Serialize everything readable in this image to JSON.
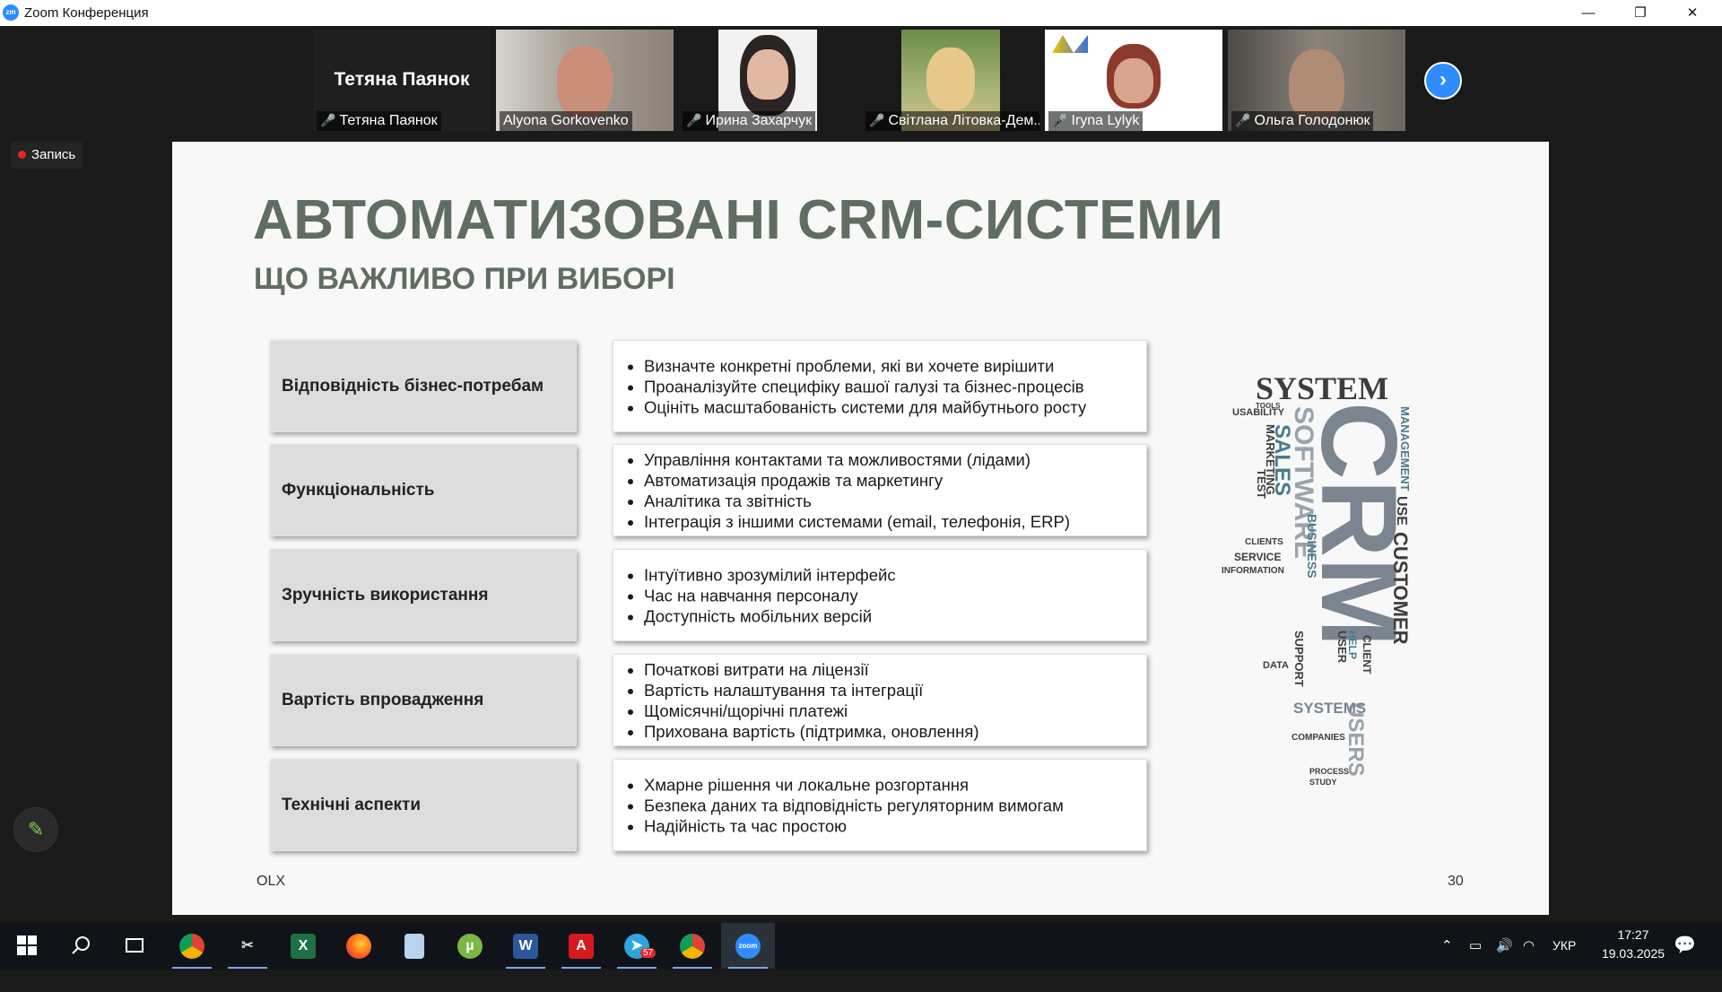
{
  "window": {
    "title": "Zoom Конференция",
    "icon_label": "zm",
    "minimize": "—",
    "restore": "❐",
    "close": "✕"
  },
  "participants": [
    {
      "name": "Тетяна Паянок",
      "display": "Тетяна Паянок",
      "muted": true
    },
    {
      "name": "Alyona Gorkovenko",
      "muted": false
    },
    {
      "name": "Ирина Захарчук",
      "muted": true
    },
    {
      "name": "Світлана Літовка-Дем...",
      "muted": true
    },
    {
      "name": "Iryna Lylyk",
      "muted": true
    },
    {
      "name": "Ольга Голодонюк",
      "muted": true
    }
  ],
  "next_arrow": "›",
  "recording": {
    "label": "Запись"
  },
  "slide": {
    "title": "АВТОМАТИЗОВАНІ CRM-СИСТЕМИ",
    "subtitle": "ЩО ВАЖЛИВО ПРИ ВИБОРІ",
    "rows": [
      {
        "category": "Відповідність бізнес-потребам",
        "items": [
          "Визначте конкретні проблеми, які ви хочете вирішити",
          "Проаналізуйте специфіку вашої галузі та бізнес-процесів",
          "Оцініть масштабованість системи для майбутнього росту"
        ]
      },
      {
        "category": "Функціональність",
        "items": [
          "Управління контактами та можливостями (лідами)",
          "Автоматизація продажів та маркетингу",
          "Аналітика та звітність",
          "Інтеграція з іншими системами (email, телефонія, ERP)"
        ]
      },
      {
        "category": "Зручність використання",
        "items": [
          "Інтуїтивно зрозумілий інтерфейс",
          "Час на навчання персоналу",
          "Доступність мобільних версій"
        ]
      },
      {
        "category": "Вартість впровадження",
        "items": [
          "Початкові витрати на ліцензії",
          "Вартість налаштування та інтеграції",
          "Щомісячні/щорічні платежі",
          "Прихована вартість (підтримка, оновлення)"
        ]
      },
      {
        "category": "Технічні аспекти",
        "items": [
          "Хмарне рішення чи локальне розгортання",
          "Безпека даних та відповідність регуляторним вимогам",
          "Надійність та час простою"
        ]
      }
    ],
    "footer_left": "OLX",
    "page_number": "30",
    "wordcloud_words": [
      "CRM",
      "SYSTEM",
      "SOFTWARE",
      "SALES",
      "CUSTOMER",
      "MANAGEMENT",
      "MARKETING",
      "USERS",
      "SYSTEMS",
      "SERVICE",
      "INFORMATION",
      "BUSINESS",
      "SUPPORT",
      "USABILITY",
      "TEST",
      "CLIENTS",
      "DATA",
      "COMPANIES",
      "USER",
      "CLIENT",
      "HELP",
      "PROCESS",
      "STUDY",
      "USE",
      "TOOLS"
    ]
  },
  "taskbar": {
    "apps": [
      "start",
      "search",
      "task-view",
      "chrome",
      "scissors",
      "excel",
      "firefox",
      "notepad",
      "utorrent",
      "word",
      "acrobat",
      "telegram",
      "chrome-2",
      "zoom"
    ],
    "telegram_badge": "57",
    "language": "УКР",
    "time": "17:27",
    "date": "19.03.2025"
  },
  "colors": {
    "slide_title": "#5f6d63",
    "zoom_blue": "#2d8cff",
    "record_red": "#e02828"
  }
}
